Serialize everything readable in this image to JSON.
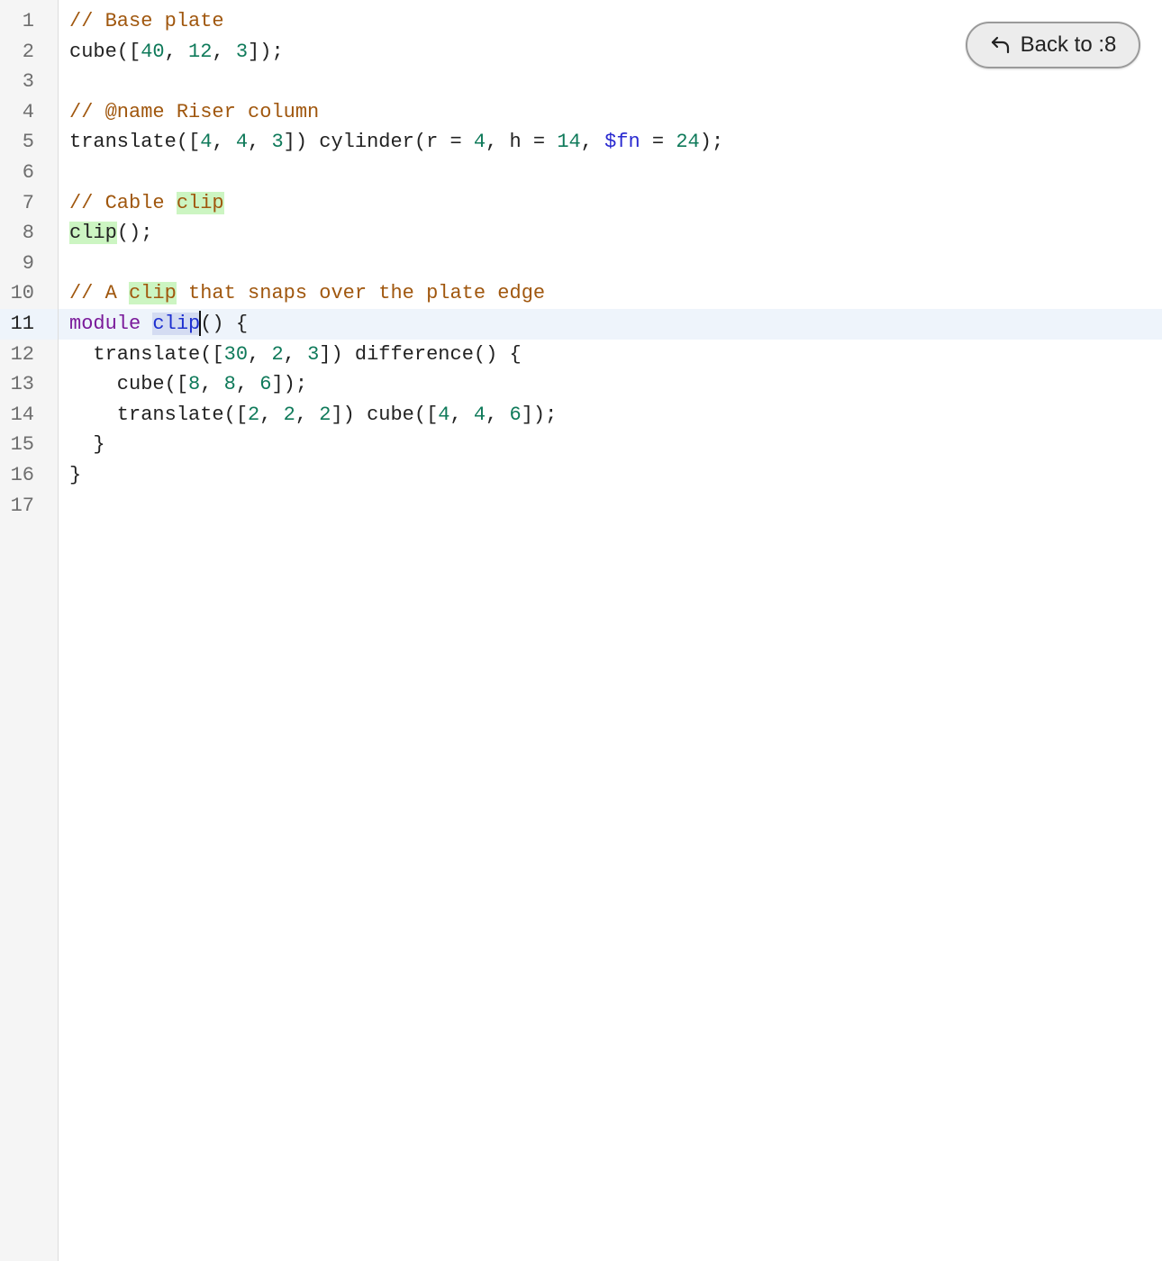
{
  "editor": {
    "active_line": 11,
    "line_numbers": [
      "1",
      "2",
      "3",
      "4",
      "5",
      "6",
      "7",
      "8",
      "9",
      "10",
      "11",
      "12",
      "13",
      "14",
      "15",
      "16",
      "17"
    ],
    "lines": [
      [
        {
          "t": "c",
          "s": "// Base plate"
        }
      ],
      [
        {
          "t": "p",
          "s": "cube(["
        },
        {
          "t": "n",
          "s": "40"
        },
        {
          "t": "p",
          "s": ", "
        },
        {
          "t": "n",
          "s": "12"
        },
        {
          "t": "p",
          "s": ", "
        },
        {
          "t": "n",
          "s": "3"
        },
        {
          "t": "p",
          "s": "]);"
        }
      ],
      [],
      [
        {
          "t": "c",
          "s": "// @name Riser column"
        }
      ],
      [
        {
          "t": "p",
          "s": "translate(["
        },
        {
          "t": "n",
          "s": "4"
        },
        {
          "t": "p",
          "s": ", "
        },
        {
          "t": "n",
          "s": "4"
        },
        {
          "t": "p",
          "s": ", "
        },
        {
          "t": "n",
          "s": "3"
        },
        {
          "t": "p",
          "s": "]) cylinder(r = "
        },
        {
          "t": "n",
          "s": "4"
        },
        {
          "t": "p",
          "s": ", h = "
        },
        {
          "t": "n",
          "s": "14"
        },
        {
          "t": "p",
          "s": ", "
        },
        {
          "t": "v",
          "s": "$fn"
        },
        {
          "t": "p",
          "s": " = "
        },
        {
          "t": "n",
          "s": "24"
        },
        {
          "t": "p",
          "s": ");"
        }
      ],
      [],
      [
        {
          "t": "c",
          "s": "// Cable "
        },
        {
          "t": "ch",
          "s": "clip"
        }
      ],
      [
        {
          "t": "h",
          "s": "clip"
        },
        {
          "t": "p",
          "s": "();"
        }
      ],
      [],
      [
        {
          "t": "c",
          "s": "// A "
        },
        {
          "t": "ch",
          "s": "clip"
        },
        {
          "t": "c",
          "s": " that snaps over the plate edge"
        }
      ],
      [
        {
          "t": "k",
          "s": "module"
        },
        {
          "t": "p",
          "s": " "
        },
        {
          "t": "sel",
          "s": "clip"
        },
        {
          "t": "caret",
          "s": ""
        },
        {
          "t": "p",
          "s": "() {"
        }
      ],
      [
        {
          "t": "p",
          "s": "  translate(["
        },
        {
          "t": "n",
          "s": "30"
        },
        {
          "t": "p",
          "s": ", "
        },
        {
          "t": "n",
          "s": "2"
        },
        {
          "t": "p",
          "s": ", "
        },
        {
          "t": "n",
          "s": "3"
        },
        {
          "t": "p",
          "s": "]) difference() {"
        }
      ],
      [
        {
          "t": "p",
          "s": "    cube(["
        },
        {
          "t": "n",
          "s": "8"
        },
        {
          "t": "p",
          "s": ", "
        },
        {
          "t": "n",
          "s": "8"
        },
        {
          "t": "p",
          "s": ", "
        },
        {
          "t": "n",
          "s": "6"
        },
        {
          "t": "p",
          "s": "]);"
        }
      ],
      [
        {
          "t": "p",
          "s": "    translate(["
        },
        {
          "t": "n",
          "s": "2"
        },
        {
          "t": "p",
          "s": ", "
        },
        {
          "t": "n",
          "s": "2"
        },
        {
          "t": "p",
          "s": ", "
        },
        {
          "t": "n",
          "s": "2"
        },
        {
          "t": "p",
          "s": "]) cube(["
        },
        {
          "t": "n",
          "s": "4"
        },
        {
          "t": "p",
          "s": ", "
        },
        {
          "t": "n",
          "s": "4"
        },
        {
          "t": "p",
          "s": ", "
        },
        {
          "t": "n",
          "s": "6"
        },
        {
          "t": "p",
          "s": "]);"
        }
      ],
      [
        {
          "t": "p",
          "s": "  }"
        }
      ],
      [
        {
          "t": "p",
          "s": "}"
        }
      ],
      []
    ]
  },
  "back_button": {
    "label": "Back to :8",
    "icon": "undo-arrow-icon"
  },
  "colors": {
    "comment": "#a0570e",
    "number": "#0f7a5a",
    "keyword": "#7a1a9a",
    "variable": "#2a2ad0",
    "match_highlight": "#ccf5c2",
    "selection": "#d4dcf2",
    "active_line": "#eef4fb"
  }
}
